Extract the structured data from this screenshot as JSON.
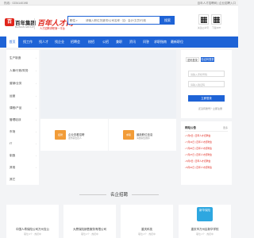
{
  "topbar": {
    "hotline": "热线：0234140198",
    "right_text": "百年人才招聘网 | 企业招聘入口"
  },
  "header": {
    "logo_mark": "百",
    "logo_text": "百年集团",
    "logo_sub": "BAINIAN GROUP",
    "brand_title": "百年人才网",
    "brand_slogan": "人才招聘求职第一平台",
    "qr_labels": [
      "关注公众号",
      "下载APP"
    ]
  },
  "search": {
    "type_label": "职位",
    "placeholder": "请输入职位关键词/公司名称 · 如：会计/文员/行政",
    "button_label": "搜索"
  },
  "nav": {
    "items": [
      "首页",
      "找工作",
      "找人才",
      "找企业",
      "招聘会",
      "校招",
      "公招",
      "兼职",
      "资讯",
      "问答",
      "求职指南",
      "最新职位"
    ]
  },
  "categories": [
    "生产制造",
    "人事/行政/财务",
    "营销/业务",
    "运营",
    "课程/产品",
    "管理培训",
    "市场",
    "IT",
    "制造",
    "其他",
    "其它"
  ],
  "features": [
    {
      "icon": "招聘",
      "title": "企业查看招聘",
      "sub": "发布职位招人"
    },
    {
      "icon": "求职",
      "title": "最新职位信息",
      "sub": "海量职位推荐"
    }
  ],
  "login": {
    "tab_inactive": "密码登录",
    "tab_active": "验证码登录",
    "phone_placeholder": "请输入手机号码",
    "code_placeholder": "请输入验证码",
    "submit_label": "立即登录",
    "link": "还没有账号？立即注册"
  },
  "news": {
    "title": "网站公告",
    "more": "更多",
    "items": [
      "7月6日 | 百年人才招聘会",
      "7月13日 | 百年人才招聘会",
      "7月20日 | 百年人才招聘会",
      "7月27日 | 百年人才招聘会",
      "8月3日 | 百年人才招聘会",
      "8月10日 | 百年人才招聘会"
    ]
  },
  "section": {
    "title": "名企招聘"
  },
  "companies": [
    {
      "logo": "企业",
      "name": "中国人寿保险公司万州支公",
      "sub": "职位 3个 · 热招中",
      "color": "#f1f1f1"
    },
    {
      "logo": "企业",
      "name": "大厦保险销售服务有限公司",
      "sub": "职位 2个 · 热招中",
      "color": "#f1f1f1"
    },
    {
      "logo": "企业",
      "name": "重庆科技",
      "sub": "职位 4个 · 热招中",
      "color": "#f1f1f1"
    },
    {
      "logo": "新华保险",
      "name": "重庆市万州区新华学校",
      "sub": "职位 1个 · 热招中",
      "color": "#2ea7e0"
    }
  ],
  "colors": {
    "brand_red": "#e0251b",
    "nav_blue": "#1e63d6",
    "feature_orange": "#f29c38",
    "feature_green": "#3bb56b"
  }
}
